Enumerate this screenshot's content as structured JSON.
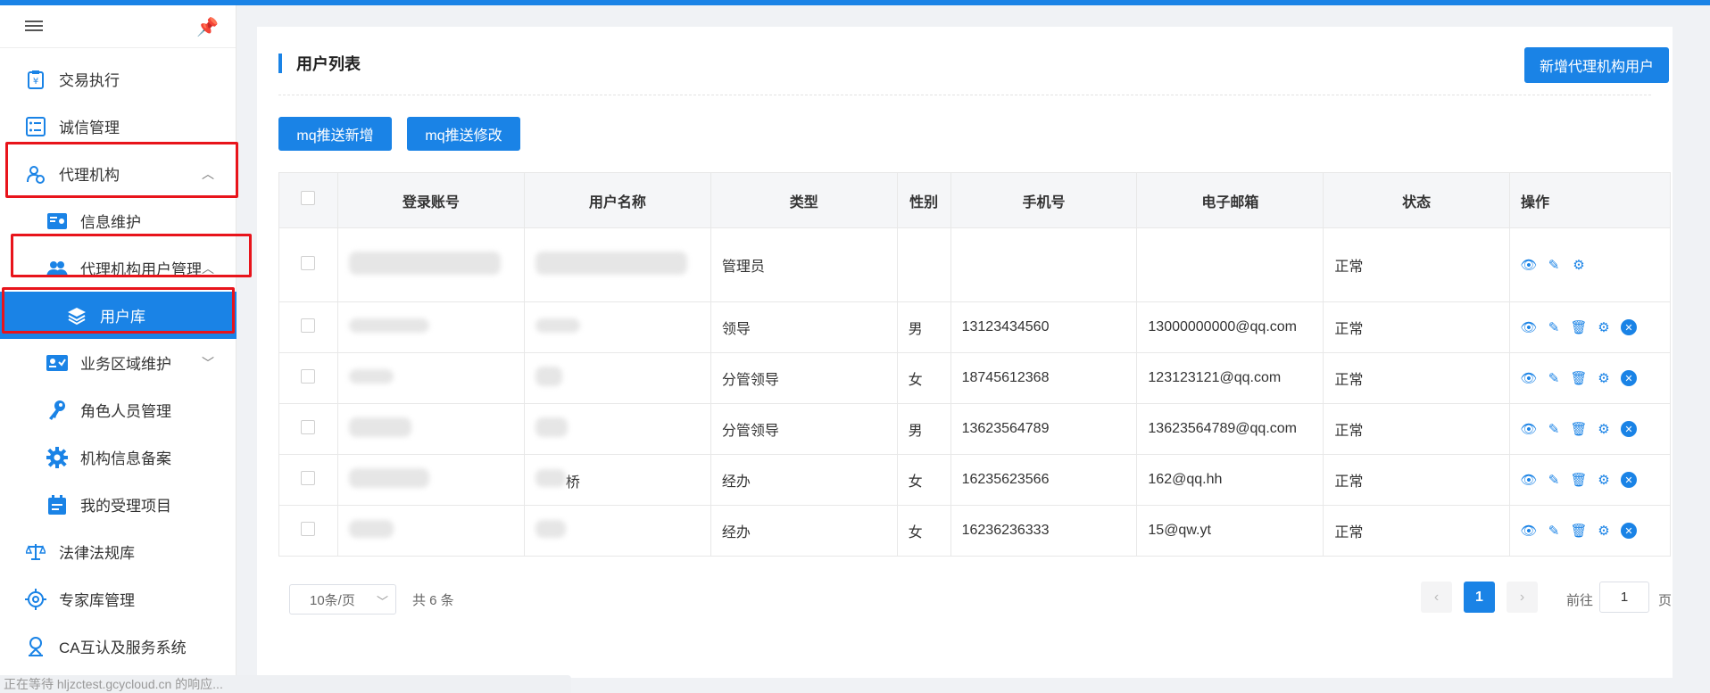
{
  "sidebar": {
    "items": [
      {
        "label": "交易执行",
        "icon": "clipboard-yen-icon"
      },
      {
        "label": "诚信管理",
        "icon": "checklist-icon"
      },
      {
        "label": "代理机构",
        "icon": "agency-user-icon"
      },
      {
        "label": "信息维护",
        "icon": "info-card-icon"
      },
      {
        "label": "代理机构用户管理",
        "icon": "users-icon"
      },
      {
        "label": "用户库",
        "icon": "layers-icon"
      },
      {
        "label": "业务区域维护",
        "icon": "id-card-icon"
      },
      {
        "label": "角色人员管理",
        "icon": "key-icon"
      },
      {
        "label": "机构信息备案",
        "icon": "gear-icon"
      },
      {
        "label": "我的受理项目",
        "icon": "calendar-icon"
      },
      {
        "label": "法律法规库",
        "icon": "scales-icon"
      },
      {
        "label": "专家库管理",
        "icon": "settings-icon"
      },
      {
        "label": "CA互认及服务系统",
        "icon": "ca-badge-icon"
      }
    ]
  },
  "main": {
    "title": "用户列表",
    "add_button": "新增代理机构用户",
    "mq_add": "mq推送新增",
    "mq_edit": "mq推送修改"
  },
  "table": {
    "headers": [
      "登录账号",
      "用户名称",
      "类型",
      "性别",
      "手机号",
      "电子邮箱",
      "状态",
      "操作"
    ],
    "rows": [
      {
        "type": "管理员",
        "gender": "",
        "phone": "",
        "email": "",
        "status": "正常"
      },
      {
        "type": "领导",
        "gender": "男",
        "phone": "13123434560",
        "email": "13000000000@qq.com",
        "status": "正常"
      },
      {
        "type": "分管领导",
        "gender": "女",
        "phone": "18745612368",
        "email": "123123121@qq.com",
        "status": "正常"
      },
      {
        "type": "分管领导",
        "gender": "男",
        "phone": "13623564789",
        "email": "13623564789@qq.com",
        "status": "正常"
      },
      {
        "type": "经办",
        "gender": "女",
        "phone": "16235623566",
        "email": "162@qq.hh",
        "status": "正常"
      },
      {
        "type": "经办",
        "gender": "女",
        "phone": "16236236333",
        "email": "15@qw.yt",
        "status": "正常"
      }
    ],
    "row0_name_fragment": "",
    "row4_name_fragment": "桥"
  },
  "pagination": {
    "page_size": "10条/页",
    "total": "共 6 条",
    "current_page": "1",
    "goto_label": "前往",
    "goto_value": "1",
    "page_suffix": "页"
  },
  "status_bar": "正在等待 hljzctest.gcycloud.cn 的响应...",
  "colors": {
    "accent": "#1a83e6",
    "highlight_box": "#e8141b"
  }
}
